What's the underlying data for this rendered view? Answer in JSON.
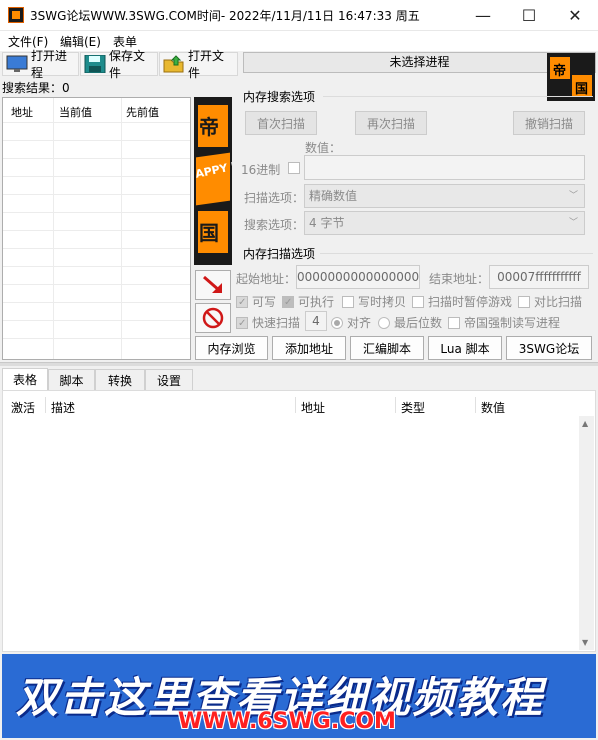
{
  "window": {
    "title": "3SWG论坛WWW.3SWG.COM时间- 2022年/11月/11日 16:47:33 周五",
    "minimize": "—",
    "maximize": "☐",
    "close": "✕"
  },
  "menu": [
    "文件(F)",
    "编辑(E)",
    "表单"
  ],
  "toolbar": {
    "open_process": "打开进程",
    "save_file": "保存文件",
    "open_file": "打开文件",
    "process_status": "未选择进程"
  },
  "logo_chars": [
    "帝",
    "国"
  ],
  "search_result": "搜索结果：0",
  "result_columns": [
    "地址",
    "当前值",
    "先前值"
  ],
  "banner": {
    "chars": [
      "帝",
      "国"
    ],
    "text": "APPY LI"
  },
  "scan": {
    "group_title": "内存搜索选项",
    "first_scan": "首次扫描",
    "next_scan": "再次扫描",
    "undo_scan": "撤销扫描",
    "value_label": "数值：",
    "hex_label": "16进制",
    "scan_type_label": "扫描选项：",
    "scan_type_value": "精确数值",
    "value_type_label": "搜索选项：",
    "value_type_value": "4 字节"
  },
  "memscan": {
    "group_title": "内存扫描选项",
    "start_label": "起始地址：",
    "start_value": "0000000000000000",
    "end_label": "结束地址：",
    "end_value": "00007fffffffffff",
    "writable": "可写",
    "executable": "可执行",
    "copy_on_write": "写时拷贝",
    "pause_game": "扫描时暂停游戏",
    "compare": "对比扫描",
    "fast_scan": "快速扫描",
    "fast_scan_value": "4",
    "align": "对齐",
    "last_digits": "最后位数",
    "force_rw": "帝国强制读写进程"
  },
  "bottom_buttons": [
    "内存浏览",
    "添加地址",
    "汇编脚本",
    "Lua 脚本",
    "3SWG论坛"
  ],
  "tabs": [
    "表格",
    "脚本",
    "转换",
    "设置"
  ],
  "table_columns": [
    "激活",
    "描述",
    "地址",
    "类型",
    "数值"
  ],
  "ad": {
    "main": "双击这里查看详细视频教程",
    "url": "WWW.6SWG.COM"
  },
  "colors": {
    "accent_orange": "#ff8c00",
    "ad_blue": "#2a6bd4",
    "ad_url_red": "#ff2020"
  }
}
